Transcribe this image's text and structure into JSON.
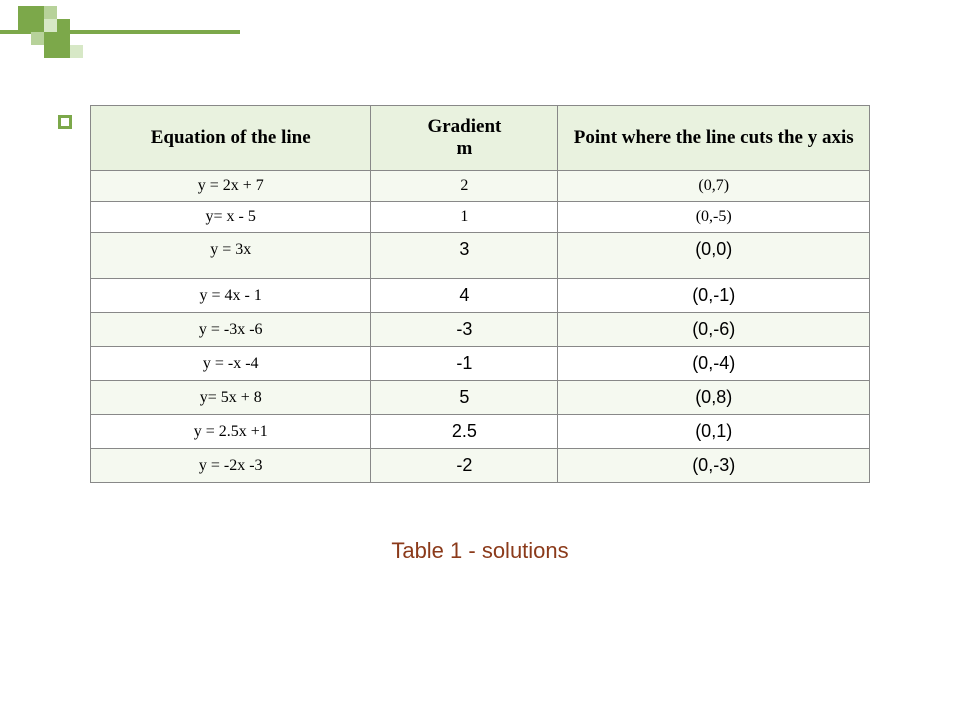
{
  "table": {
    "headers": {
      "col1": "Equation of the line",
      "col2": "Gradient\nm",
      "col3": "Point where the line cuts the y axis"
    },
    "rows": [
      {
        "eq": "y = 2x + 7",
        "m": "2",
        "pt": "(0,7)",
        "style": "serif"
      },
      {
        "eq": "y= x - 5",
        "m": "1",
        "pt": "(0,-5)",
        "style": "serif"
      },
      {
        "eq": "y = 3x",
        "m": "3",
        "pt": "(0,0)",
        "style": "sans"
      },
      {
        "eq": "y = 4x - 1",
        "m": "4",
        "pt": "(0,-1)",
        "style": "sans"
      },
      {
        "eq": "y = -3x -6",
        "m": "-3",
        "pt": "(0,-6)",
        "style": "sans"
      },
      {
        "eq": "y = -x -4",
        "m": "-1",
        "pt": "(0,-4)",
        "style": "sans"
      },
      {
        "eq": "y= 5x + 8",
        "m": "5",
        "pt": "(0,8)",
        "style": "sans"
      },
      {
        "eq": "y = 2.5x +1",
        "m": "2.5",
        "pt": "(0,1)",
        "style": "sans"
      },
      {
        "eq": "y = -2x -3",
        "m": "-2",
        "pt": "(0,-3)",
        "style": "sans"
      }
    ]
  },
  "caption": "Table 1 - solutions",
  "chart_data": {
    "type": "table",
    "title": "Table 1 - solutions",
    "columns": [
      "Equation of the line",
      "Gradient m",
      "Point where the line cuts the y axis"
    ],
    "rows": [
      [
        "y = 2x + 7",
        "2",
        "(0,7)"
      ],
      [
        "y= x - 5",
        "1",
        "(0,-5)"
      ],
      [
        "y = 3x",
        "3",
        "(0,0)"
      ],
      [
        "y = 4x - 1",
        "4",
        "(0,-1)"
      ],
      [
        "y = -3x -6",
        "-3",
        "(0,-6)"
      ],
      [
        "y = -x -4",
        "-1",
        "(0,-4)"
      ],
      [
        "y= 5x + 8",
        "5",
        "(0,8)"
      ],
      [
        "y = 2.5x +1",
        "2.5",
        "(0,1)"
      ],
      [
        "y = -2x -3",
        "-2",
        "(0,-3)"
      ]
    ]
  }
}
